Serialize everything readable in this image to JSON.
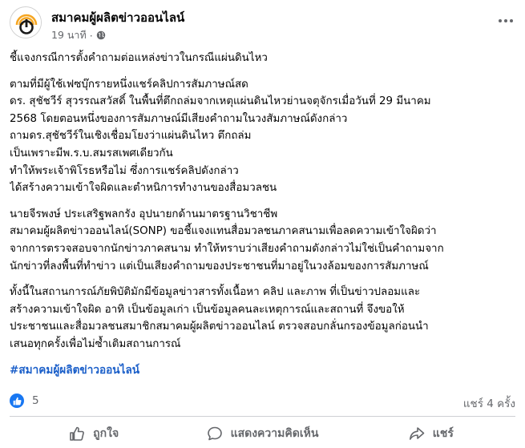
{
  "header": {
    "page_name": "สมาคมผู้ผลิตข่าวออนไลน์",
    "time": "19 นาที",
    "separator": "·",
    "privacy_icon": "globe-icon",
    "more_icon": "more-horizontal-icon"
  },
  "body": {
    "paragraphs": [
      [
        "ชี้แจงกรณีการตั้งคำถามต่อแหล่งข่าวในกรณีแผ่นดินไหว"
      ],
      [
        "ตามที่มีผู้ใช้เฟซบุ๊กรายหนึ่งแชร์คลิปการสัมภาษณ์สด",
        "ดร. สุชัชวีร์ สุวรรณสวัสดิ์ ในพื้นที่ตึกถล่มจากเหตุแผ่นดินไหวย่านจตุจักรเมื่อวันที่ 29 มีนาคม",
        "2568 โดยตอนหนึ่งของการสัมภาษณ์มีเสียงคำถามในวงสัมภาษณ์ดังกล่าว",
        "ถามดร.สุชัชวีร์ในเชิงเชื่อมโยงว่าแผ่นดินไหว ตึกถล่ม",
        "เป็นเพราะมีพ.ร.บ.สมรสเพศเดียวกัน",
        "ทำให้พระเจ้าพิโรธหรือไม่  ซึ่งการแชร์คลิปดังกล่าว",
        "ได้สร้างความเข้าใจผิดและตำหนิการทำงานของสื่อมวลชน"
      ],
      [
        "นายจีรพงษ์ ประเสริฐพลกรัง อุปนายกด้านมาตรฐานวิชาชีพ",
        "สมาคมผู้ผลิตข่าวออนไลน์(SONP) ขอชี้แจงแทนสื่อมวลชนภาคสนามเพื่อลดความเข้าใจผิดว่า",
        "จากการตรวจสอบจากนักข่าวภาคสนาม ทำให้ทราบว่าเสียงคำถามดังกล่าวไม่ใช่เป็นคำถามจาก",
        "นักข่าวที่ลงพื้นที่ทำข่าว แต่เป็นเสียงคำถามของประชาชนที่มาอยู่ในวงล้อมของการสัมภาษณ์"
      ],
      [
        "ทั้งนี้ในสถานการณ์ภัยพิบัติมักมีข้อมูลข่าวสารทั้งเนื้อหา คลิป และภาพ ที่เป็นข่าวปลอมและ",
        "สร้างความเข้าใจผิด อาทิ เป็นข้อมูลเก่า เป็นข้อมูลคนละเหตุการณ์และสถานที่ จึงขอให้",
        "ประชาชนและสื่อมวลชนสมาชิกสมาคมผู้ผลิตข่าวออนไลน์ ตรวจสอบกลั่นกรองข้อมูลก่อนนำ",
        "เสนอทุกครั้งเพื่อไม่ซ้ำเติมสถานการณ์"
      ]
    ],
    "hashtag": "#สมาคมผู้ผลิตข่าวออนไลน์"
  },
  "reactions": {
    "icon": "like-icon",
    "count": "5",
    "shares": "แชร์ 4 ครั้ง"
  },
  "actions": {
    "like": {
      "label": "ถูกใจ",
      "icon": "thumbs-up-icon"
    },
    "comment": {
      "label": "แสดงความคิดเห็น",
      "icon": "comment-icon"
    },
    "share": {
      "label": "แชร์",
      "icon": "share-icon"
    }
  },
  "colors": {
    "accent": "#1877f2",
    "hashtag": "#1b5fc9",
    "secondary_text": "#65676b",
    "logo_orange": "#f5a623"
  }
}
